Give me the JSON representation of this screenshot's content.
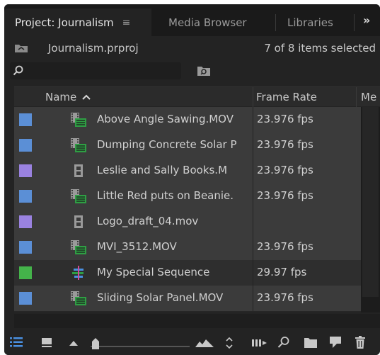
{
  "tabs": {
    "project": "Project: Journalism",
    "menu_glyph": "≡",
    "media_browser": "Media Browser",
    "libraries": "Libraries",
    "overflow": "»"
  },
  "project": {
    "file_name": "Journalism.prproj",
    "selection_status": "7 of 8 items selected"
  },
  "search": {
    "value": ""
  },
  "columns": {
    "name": "Name",
    "frame_rate": "Frame Rate",
    "media": "Me"
  },
  "items": [
    {
      "label_color": "#5b8fd6",
      "type": "clip",
      "name": "Above Angle Sawing.MOV",
      "frame_rate": "23.976 fps",
      "selected": true
    },
    {
      "label_color": "#5b8fd6",
      "type": "clip",
      "name": "Dumping Concrete Solar P",
      "frame_rate": "23.976 fps",
      "selected": true
    },
    {
      "label_color": "#9a82e0",
      "type": "film",
      "name": "Leslie and Sally  Books.M",
      "frame_rate": "23.976 fps",
      "selected": true
    },
    {
      "label_color": "#5b8fd6",
      "type": "clip",
      "name": "Little Red puts on Beanie.",
      "frame_rate": "23.976 fps",
      "selected": true
    },
    {
      "label_color": "#9a82e0",
      "type": "film",
      "name": "Logo_draft_04.mov",
      "frame_rate": "",
      "selected": true
    },
    {
      "label_color": "#5b8fd6",
      "type": "clip",
      "name": "MVI_3512.MOV",
      "frame_rate": "23.976 fps",
      "selected": true
    },
    {
      "label_color": "#44b34a",
      "type": "sequence",
      "name": "My Special Sequence",
      "frame_rate": "29.97 fps",
      "selected": false
    },
    {
      "label_color": "#5b8fd6",
      "type": "clip",
      "name": "Sliding Solar Panel.MOV",
      "frame_rate": "23.976 fps",
      "selected": true
    }
  ],
  "toolbar": {
    "icons": [
      "list-view-icon",
      "icon-view-icon",
      "freeform-view-icon",
      "zoom-small-icon",
      "zoom-large-icon",
      "sort-icons-icon",
      "automate-to-sequence-icon",
      "find-icon",
      "new-bin-icon",
      "new-item-icon",
      "clear-icon"
    ],
    "zoom_level": 0.05
  },
  "colors": {
    "panel_bg": "#232323",
    "selected_row": "#3b3b3b",
    "accent_blue": "#4a90e2"
  }
}
